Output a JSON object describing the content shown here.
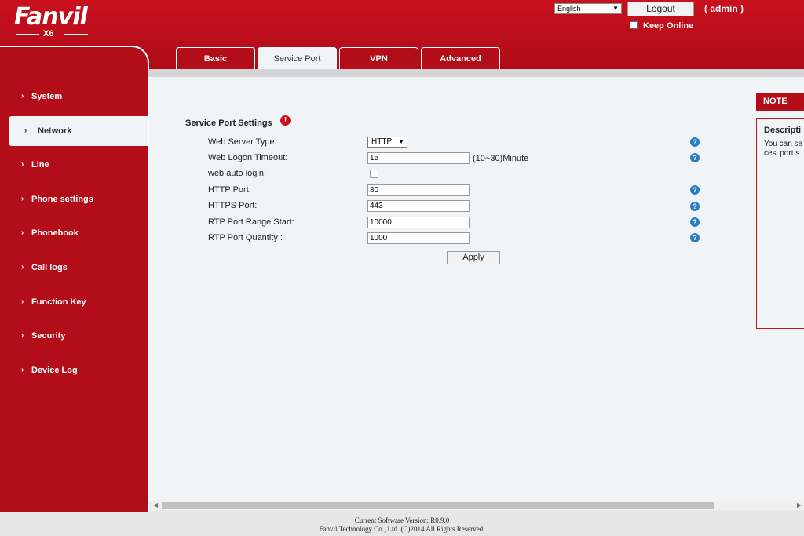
{
  "header": {
    "logo": "Fanvil",
    "model": "X6",
    "language": "English",
    "logout_label": "Logout",
    "user": "( admin )",
    "keep_online_label": "Keep Online"
  },
  "tabs": [
    {
      "label": "Basic",
      "active": false
    },
    {
      "label": "Service Port",
      "active": true
    },
    {
      "label": "VPN",
      "active": false
    },
    {
      "label": "Advanced",
      "active": false
    }
  ],
  "sidebar": {
    "items": [
      {
        "label": "System",
        "active": false
      },
      {
        "label": "Network",
        "active": true
      },
      {
        "label": "Line",
        "active": false
      },
      {
        "label": "Phone settings",
        "active": false
      },
      {
        "label": "Phonebook",
        "active": false
      },
      {
        "label": "Call logs",
        "active": false
      },
      {
        "label": "Function Key",
        "active": false
      },
      {
        "label": "Security",
        "active": false
      },
      {
        "label": "Device Log",
        "active": false
      }
    ]
  },
  "form": {
    "title": "Service Port Settings",
    "web_server_type": {
      "label": "Web Server Type:",
      "value": "HTTP"
    },
    "web_logon_timeout": {
      "label": "Web Logon Timeout:",
      "value": "15",
      "suffix": "(10~30)Minute"
    },
    "web_auto_login": {
      "label": "web auto login:",
      "checked": false
    },
    "http_port": {
      "label": "HTTP Port:",
      "value": "80"
    },
    "https_port": {
      "label": "HTTPS Port:",
      "value": "443"
    },
    "rtp_start": {
      "label": "RTP Port Range Start:",
      "value": "10000"
    },
    "rtp_quantity": {
      "label": "RTP Port Quantity :",
      "value": "1000"
    },
    "apply_label": "Apply"
  },
  "note": {
    "header": "NOTE",
    "title": "Descripti",
    "text_line1": "You can se",
    "text_line2": "ces' port s"
  },
  "footer": {
    "version": "Current Software Version: R0.9.0",
    "copyright": "Fanvil Technology Co., Ltd. (C)2014 All Rights Reserved."
  },
  "colors": {
    "brand_red": "#b30d19",
    "help_blue": "#2a7ec0",
    "content_bg": "#f0f4f7"
  },
  "icons": {
    "help": "question-circle-icon",
    "info": "info-circle-icon",
    "chevron": "chevron-right-icon"
  }
}
